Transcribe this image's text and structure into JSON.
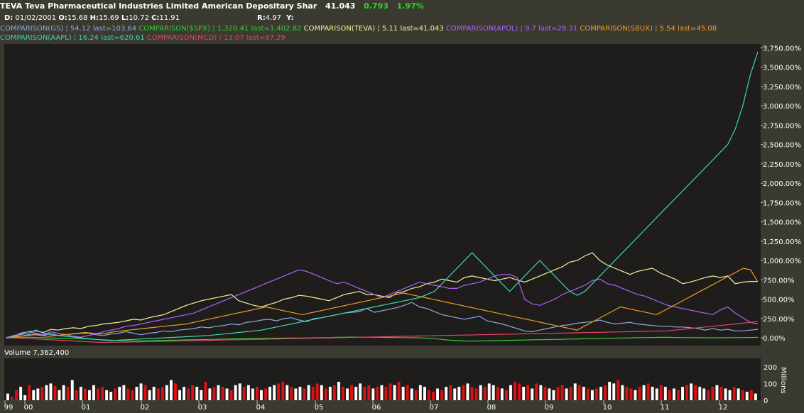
{
  "header": {
    "symbol": "TEVA",
    "name": "Teva Pharmaceutical Industries Limited American Depositary Shar",
    "last": "41.043",
    "change": "0.793",
    "change_pct": "1.97%",
    "date_label": "D:",
    "date": "01/02/2001",
    "open_label": "O:",
    "open": "15.68",
    "high_label": "H:",
    "high": "15.69",
    "low_label": "L:",
    "low": "10.72",
    "close_label": "C:",
    "close": "11.91",
    "r_label": "R:",
    "r": "4.97",
    "y_label": "Y:",
    "volume_label": "Volume",
    "volume": "7,362,400",
    "volume_axis_unit": "Millions"
  },
  "colors": {
    "background": "#3a3a31",
    "plot_bg": "#1e1d1b",
    "up_change": "#22dd22",
    "vol_up": "#ffffff",
    "vol_down": "#dd1111"
  },
  "chart_data": [
    {
      "type": "line",
      "x": [
        "99",
        "00",
        "01",
        "02",
        "03",
        "04",
        "05",
        "06",
        "07",
        "08",
        "09",
        "10",
        "11",
        "12"
      ],
      "ylim": [
        -100,
        3800
      ],
      "yticks": [
        "0.00%",
        "250.00%",
        "500.00%",
        "750.00%",
        "1,000.00%",
        "1,250.00%",
        "1,500.00%",
        "1,750.00%",
        "2,000.00%",
        "2,250.00%",
        "2,500.00%",
        "2,750.00%",
        "3,000.00%",
        "3,250.00%",
        "3,500.00%",
        "3,750.00%"
      ],
      "ytick_values": [
        0,
        250,
        500,
        750,
        1000,
        1250,
        1500,
        1750,
        2000,
        2250,
        2500,
        2750,
        3000,
        3250,
        3500,
        3750
      ],
      "grid": false,
      "series": [
        {
          "name": "COMPARISON(GS)",
          "legend": "54.12 last=103.64",
          "color": "#8fa8e0",
          "values": [
            0,
            0,
            20,
            40,
            50,
            30,
            60,
            30,
            40,
            50,
            60,
            60,
            40,
            30,
            50,
            60,
            80,
            60,
            40,
            60,
            70,
            90,
            80,
            100,
            110,
            120,
            140,
            130,
            150,
            160,
            180,
            170,
            200,
            210,
            230,
            240,
            220,
            250,
            260,
            230,
            210,
            250,
            260,
            280,
            300,
            320,
            330,
            340,
            380,
            330,
            350,
            370,
            390,
            420,
            460,
            400,
            380,
            340,
            300,
            280,
            260,
            240,
            260,
            280,
            220,
            200,
            180,
            150,
            120,
            90,
            80,
            100,
            120,
            140,
            160,
            170,
            190,
            200,
            210,
            230,
            200,
            180,
            190,
            200,
            180,
            170,
            160,
            150,
            150,
            140,
            140,
            130,
            120,
            100,
            120,
            100,
            110,
            90,
            90,
            100,
            110
          ]
        },
        {
          "name": "COMPARISON($SPX)",
          "legend": "1,320.41 last=1,402.82",
          "color": "#33cc33",
          "values": [
            0,
            0,
            5,
            8,
            5,
            2,
            0,
            -5,
            -8,
            -10,
            -12,
            -15,
            -20,
            -25,
            -30,
            -35,
            -38,
            -40,
            -40,
            -38,
            -35,
            -32,
            -30,
            -28,
            -26,
            -24,
            -22,
            -20,
            -18,
            -16,
            -14,
            -12,
            -10,
            -9,
            -8,
            -7,
            -5,
            -4,
            -3,
            -2,
            -1,
            0,
            2,
            4,
            6,
            8,
            10,
            9,
            8,
            7,
            6,
            5,
            4,
            3,
            2,
            0,
            -5,
            -10,
            -20,
            -30,
            -35,
            -40,
            -42,
            -40,
            -38,
            -36,
            -34,
            -32,
            -30,
            -28,
            -26,
            -24,
            -22,
            -20,
            -18,
            -16,
            -14,
            -12,
            -10,
            -8,
            -6,
            -4,
            -2,
            0,
            2,
            4,
            5,
            6,
            6,
            5,
            4,
            3,
            2,
            1,
            0,
            1,
            2,
            3,
            4,
            5,
            6
          ]
        },
        {
          "name": "COMPARISON(TEVA)",
          "legend": "5.11 last=41.043",
          "color": "#f2f29a",
          "values": [
            0,
            20,
            60,
            80,
            90,
            70,
            110,
            100,
            120,
            130,
            120,
            150,
            160,
            180,
            190,
            200,
            220,
            240,
            230,
            260,
            280,
            300,
            340,
            380,
            420,
            450,
            480,
            500,
            520,
            540,
            560,
            480,
            450,
            420,
            400,
            430,
            460,
            500,
            520,
            550,
            540,
            520,
            500,
            480,
            520,
            560,
            580,
            600,
            560,
            560,
            540,
            520,
            580,
            600,
            640,
            660,
            700,
            720,
            760,
            740,
            720,
            780,
            800,
            780,
            760,
            740,
            760,
            780,
            750,
            720,
            760,
            800,
            840,
            880,
            920,
            980,
            1000,
            1060,
            1100,
            1000,
            940,
            900,
            860,
            820,
            860,
            880,
            900,
            840,
            800,
            760,
            700,
            720,
            750,
            780,
            800,
            780,
            800,
            700,
            720,
            730,
            730
          ]
        },
        {
          "name": "COMPARISON(APOL)",
          "legend": "9.7 last=28.31",
          "color": "#b061ff",
          "values": [
            0,
            30,
            50,
            80,
            60,
            40,
            80,
            60,
            40,
            20,
            10,
            30,
            50,
            80,
            100,
            120,
            150,
            160,
            180,
            200,
            220,
            240,
            260,
            280,
            300,
            320,
            360,
            400,
            440,
            480,
            520,
            560,
            600,
            640,
            680,
            720,
            760,
            800,
            840,
            880,
            860,
            820,
            780,
            740,
            700,
            720,
            680,
            640,
            600,
            560,
            520,
            560,
            600,
            640,
            680,
            720,
            700,
            680,
            660,
            640,
            640,
            680,
            700,
            720,
            760,
            800,
            820,
            820,
            780,
            500,
            440,
            420,
            460,
            500,
            560,
            600,
            640,
            680,
            740,
            760,
            700,
            680,
            640,
            600,
            560,
            540,
            500,
            460,
            420,
            400,
            380,
            360,
            340,
            320,
            300,
            360,
            400,
            320,
            260,
            200,
            180
          ]
        },
        {
          "name": "COMPARISON(SBUX)",
          "legend": "5.54 last=45.08",
          "color": "#ef9c2b",
          "values": [
            0,
            10,
            20,
            30,
            40,
            30,
            20,
            30,
            40,
            50,
            60,
            70,
            60,
            50,
            60,
            80,
            90,
            100,
            110,
            120,
            130,
            140,
            150,
            160,
            170,
            180,
            200,
            220,
            240,
            260,
            280,
            300,
            320,
            340,
            360,
            380,
            400,
            380,
            360,
            340,
            320,
            300,
            320,
            340,
            360,
            380,
            400,
            420,
            440,
            460,
            480,
            500,
            520,
            540,
            560,
            580,
            560,
            540,
            520,
            500,
            480,
            460,
            440,
            420,
            400,
            380,
            360,
            340,
            320,
            300,
            280,
            260,
            240,
            220,
            200,
            180,
            160,
            140,
            120,
            100,
            150,
            200,
            250,
            300,
            350,
            400,
            380,
            360,
            340,
            320,
            300,
            350,
            400,
            450,
            500,
            550,
            600,
            650,
            700,
            750,
            800,
            850,
            900,
            880,
            720
          ]
        },
        {
          "name": "COMPARISON(AAPL)",
          "legend": "16.24 last=620.61",
          "color": "#3ed6b0",
          "values": [
            0,
            20,
            40,
            60,
            100,
            60,
            40,
            30,
            20,
            10,
            0,
            -10,
            -20,
            -30,
            -35,
            -30,
            -25,
            -20,
            -15,
            -10,
            -5,
            0,
            5,
            10,
            15,
            20,
            25,
            30,
            40,
            50,
            60,
            70,
            80,
            90,
            100,
            120,
            140,
            160,
            180,
            200,
            220,
            240,
            260,
            280,
            300,
            320,
            340,
            360,
            380,
            400,
            420,
            440,
            460,
            480,
            500,
            520,
            560,
            600,
            700,
            800,
            900,
            1000,
            1100,
            1000,
            900,
            800,
            700,
            600,
            700,
            800,
            900,
            1000,
            900,
            800,
            700,
            600,
            550,
            600,
            700,
            800,
            900,
            1000,
            1100,
            1200,
            1300,
            1400,
            1500,
            1600,
            1700,
            1800,
            1900,
            2000,
            2100,
            2200,
            2300,
            2400,
            2500,
            2700,
            3000,
            3400,
            3700
          ]
        },
        {
          "name": "COMPARISON(MCD)",
          "legend": "13.07 last=87.29",
          "color": "#e0466a",
          "values": [
            0,
            0,
            -5,
            -10,
            -15,
            -20,
            -25,
            -30,
            -35,
            -40,
            -45,
            -50,
            -55,
            -60,
            -58,
            -56,
            -54,
            -52,
            -50,
            -48,
            -46,
            -44,
            -42,
            -40,
            -38,
            -36,
            -34,
            -32,
            -30,
            -28,
            -26,
            -24,
            -22,
            -20,
            -18,
            -16,
            -14,
            -12,
            -10,
            -8,
            -6,
            -4,
            -2,
            0,
            2,
            4,
            6,
            8,
            10,
            12,
            14,
            16,
            18,
            20,
            22,
            24,
            26,
            28,
            30,
            32,
            34,
            36,
            38,
            40,
            42,
            44,
            46,
            48,
            50,
            52,
            54,
            56,
            58,
            60,
            62,
            64,
            66,
            68,
            70,
            72,
            74,
            76,
            78,
            80,
            82,
            84,
            86,
            88,
            90,
            100,
            110,
            120,
            130,
            140,
            150,
            160,
            170,
            180,
            190,
            200,
            210
          ]
        }
      ]
    },
    {
      "type": "bar",
      "name": "Volume",
      "ylim": [
        0,
        250
      ],
      "yticks": [
        "0",
        "100",
        "200"
      ],
      "ytick_values": [
        0,
        100,
        200
      ],
      "values": [
        40,
        20,
        60,
        80,
        30,
        90,
        60,
        70,
        80,
        90,
        100,
        85,
        60,
        90,
        80,
        120,
        60,
        80,
        70,
        60,
        90,
        70,
        80,
        60,
        50,
        70,
        80,
        90,
        70,
        60,
        80,
        100,
        90,
        60,
        80,
        70,
        80,
        90,
        120,
        100,
        60,
        80,
        70,
        90,
        80,
        60,
        110,
        70,
        80,
        90,
        80,
        70,
        60,
        90,
        100,
        80,
        90,
        70,
        80,
        60,
        70,
        80,
        90,
        100,
        110,
        90,
        80,
        70,
        80,
        70,
        90,
        80,
        100,
        90,
        70,
        80,
        90,
        110,
        80,
        70,
        90,
        80,
        100,
        80,
        90,
        70,
        80,
        90,
        80,
        100,
        90,
        110,
        80,
        90,
        70,
        60,
        90,
        80,
        60,
        50,
        70,
        60,
        80,
        90,
        70,
        80,
        90,
        100,
        80,
        70,
        90,
        80,
        100,
        90,
        80,
        70,
        60,
        90,
        110,
        100,
        80,
        90,
        70,
        100,
        90,
        80,
        70,
        60,
        80,
        90,
        70,
        80,
        100,
        90,
        80,
        70,
        60,
        70,
        80,
        90,
        110,
        100,
        120,
        90,
        80,
        70,
        60,
        80,
        90,
        100,
        80,
        70,
        90,
        80,
        60,
        70,
        60,
        80,
        90,
        100,
        90,
        80,
        70,
        60,
        80,
        90,
        80,
        70,
        60,
        80,
        70,
        60,
        50,
        60,
        40
      ],
      "down": [
        0,
        1,
        1,
        0,
        0,
        1,
        0,
        0,
        1,
        0,
        0,
        1,
        0,
        0,
        1,
        0,
        1,
        0,
        1,
        0,
        0,
        1,
        1,
        0,
        0,
        1,
        0,
        0,
        1,
        1,
        0,
        0,
        1,
        0,
        0,
        1,
        1,
        0,
        0,
        1,
        0,
        0,
        1,
        1,
        0,
        0,
        1,
        0,
        1,
        0,
        1,
        0,
        1,
        0,
        0,
        1,
        0,
        0,
        1,
        0,
        1,
        0,
        0,
        1,
        1,
        0,
        1,
        0,
        0,
        1,
        0,
        1,
        1,
        0,
        1,
        0,
        1,
        0,
        1,
        0,
        1,
        0,
        0,
        1,
        1,
        0,
        1,
        0,
        1,
        1,
        0,
        1,
        0,
        1,
        0,
        1,
        0,
        0,
        1,
        1,
        0,
        1,
        0,
        1,
        0,
        0,
        1,
        0,
        1,
        1,
        0,
        1,
        0,
        0,
        1,
        0,
        1,
        0,
        1,
        1,
        0,
        1,
        0,
        1,
        0,
        1,
        0,
        0,
        1,
        1,
        0,
        1,
        0,
        1,
        0,
        1,
        0,
        1,
        0,
        1,
        0,
        0,
        1,
        0,
        1,
        1,
        0,
        1,
        0,
        1,
        0,
        0,
        1,
        0,
        1,
        0,
        1,
        0,
        1,
        0,
        1,
        0,
        0,
        1,
        1,
        0,
        1,
        0,
        0,
        1,
        0,
        1,
        0,
        1,
        0
      ]
    }
  ]
}
